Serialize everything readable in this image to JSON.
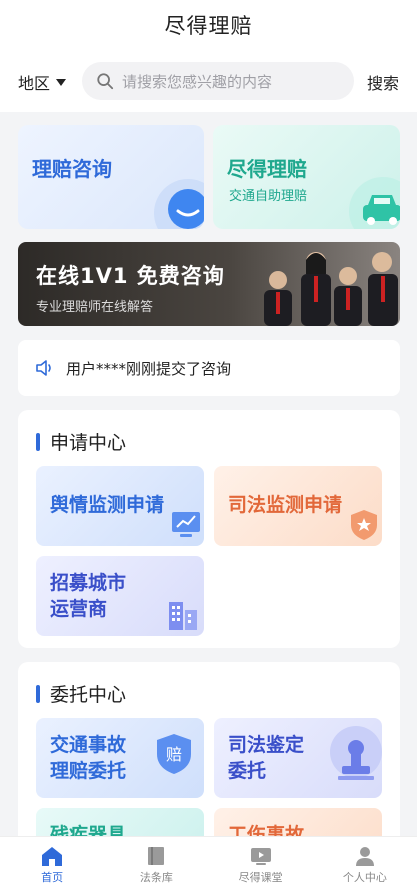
{
  "header": {
    "title": "尽得理赔"
  },
  "search": {
    "region": "地区",
    "placeholder": "请搜索您感兴趣的内容",
    "button": "搜索"
  },
  "quick_cards": [
    {
      "title": "理赔咨询"
    },
    {
      "title": "尽得理赔",
      "subtitle": "交通自助理赔"
    }
  ],
  "banner": {
    "title": "在线1V1  免费咨询",
    "subtitle": "专业理赔师在线解答"
  },
  "notice": {
    "text": "用户****刚刚提交了咨询"
  },
  "apply_center": {
    "title": "申请中心",
    "items": [
      {
        "label": "舆情监测申请"
      },
      {
        "label": "司法监测申请"
      },
      {
        "label": "招募城市",
        "label2": "运营商"
      }
    ]
  },
  "entrust_center": {
    "title": "委托中心",
    "items": [
      {
        "label": "交通事故",
        "label2": "理赔委托",
        "badge": "赔"
      },
      {
        "label": "司法鉴定",
        "label2": "委托"
      },
      {
        "label": "残疾器具"
      },
      {
        "label": "工伤事故"
      }
    ]
  },
  "tabbar": [
    {
      "label": "首页",
      "icon": "home-icon",
      "active": true
    },
    {
      "label": "法条库",
      "icon": "book-icon",
      "active": false
    },
    {
      "label": "尽得课堂",
      "icon": "video-icon",
      "active": false
    },
    {
      "label": "个人中心",
      "icon": "user-icon",
      "active": false
    }
  ],
  "colors": {
    "accent": "#2f6ad9",
    "teal": "#1fa88e",
    "orange": "#e2683a"
  }
}
